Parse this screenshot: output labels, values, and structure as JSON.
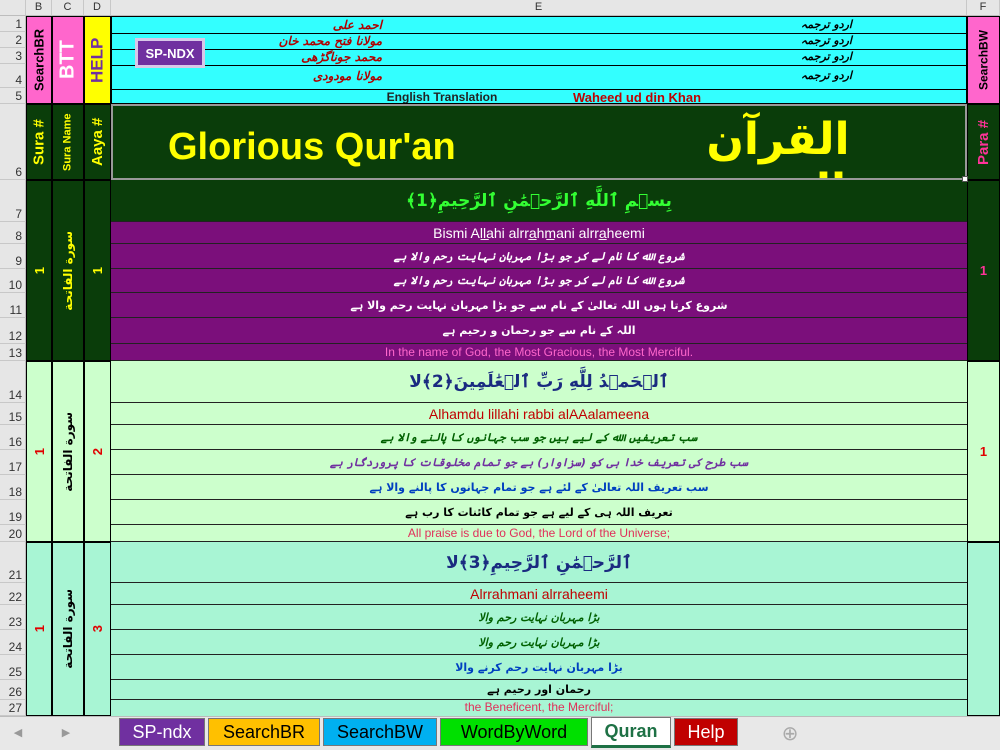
{
  "columns": [
    "B",
    "C",
    "D",
    "E",
    "F"
  ],
  "rows": [
    "1",
    "2",
    "3",
    "4",
    "5",
    "6",
    "7",
    "8",
    "9",
    "10",
    "11",
    "12",
    "13",
    "14",
    "15",
    "16",
    "17",
    "18",
    "19",
    "20",
    "21",
    "22",
    "23",
    "24",
    "25",
    "26",
    "27"
  ],
  "header": {
    "search_br": "SearchBR",
    "btt": "BTT",
    "help": "HELP",
    "search_bw": "SearchBW",
    "sp_ndx": "SP-NDX",
    "translators": [
      {
        "name": "احمد علی",
        "label": "اردو ترجمہ"
      },
      {
        "name": "مولانا فتح محمد خان",
        "label": "اردو ترجمہ"
      },
      {
        "name": "محمد جوناگڑھی",
        "label": "اردو ترجمہ"
      },
      {
        "name": "مولانا مودودی",
        "label": "اردو ترجمہ"
      }
    ],
    "english_label": "English Translation",
    "english_translator": "Waheed ud din Khan",
    "sura_no": "Sura #",
    "sura_name": "Sura Name",
    "aaya_no": "Aaya #",
    "title_en": "Glorious Qur'an",
    "title_ar": "القرآن المجید",
    "para_no": "Para #"
  },
  "verses": [
    {
      "sura": "1",
      "sura_name": "سورة الفاتحة",
      "aaya": "1",
      "para": "1",
      "arabic": "بِسۡمِ ٱللَّهِ ٱلرَّحۡمَٰنِ ٱلرَّحِيمِ﴿1﴾",
      "transliteration": "Bismi All̲ahi alrra̲hm̲ani alrra̲heemi",
      "urdu": [
        "شروع الله کا نام لے کر جو بڑا مہربان نہایت رحم والا ہے",
        "شروع الله کا نام لے کر جو بڑا مہربان نہایت رحم والا ہے",
        "شروع کرتا ہوں اللہ تعالیٰ کے نام سے جو بڑا مہربان نہایت رحم والا ہے",
        "اللہ کے نام سے جو رحمان و رحیم ہے"
      ],
      "english": "In the name of God, the Most Gracious, the Most Merciful."
    },
    {
      "sura": "1",
      "sura_name": "سورة الفاتحة",
      "aaya": "2",
      "para": "1",
      "arabic": "ٱلۡحَمۡدُ لِلَّهِ رَبِّ ٱلۡعَٰلَمِينَ﴿2﴾لا",
      "transliteration": "Alhamdu lillahi rabbi alAAalameena",
      "urdu": [
        "سب تعریفیں الله کے لیے ہیں جو سب جہانوں کا پالنے والا ہے",
        "سب طرح کی تعریف خدا ہی کو (سزاوار) ہے جو تمام مخلوقات کا پروردگار ہے",
        "سب تعریف اللہ تعالیٰ کے لئے ہے جو تمام جہانوں کا پالنے والا ہے",
        "تعریف اللہ ہی کے لیے ہے جو تمام کائنات کا رب ہے"
      ],
      "english": "All praise is due to God, the Lord of the Universe;"
    },
    {
      "sura": "1",
      "sura_name": "سورة الفاتحة",
      "aaya": "3",
      "para": "",
      "arabic": "ٱلرَّحۡمَٰنِ ٱلرَّحِيمِ﴿3﴾لا",
      "transliteration": "Alrrahmani alrraheemi",
      "urdu": [
        "بڑا مہربان نہایت رحم والا",
        "بڑا مہربان نہایت رحم والا",
        "بڑا مہربان نہایت رحم کرنے والا",
        "رحمان اور رحیم ہے"
      ],
      "english": "the Beneficent, the Merciful;"
    }
  ],
  "tabs": [
    {
      "label": "SP-ndx",
      "bg": "#7030a0",
      "fg": "#ffffff"
    },
    {
      "label": "SearchBR",
      "bg": "#ffc000",
      "fg": "#000000"
    },
    {
      "label": "SearchBW",
      "bg": "#00b0f0",
      "fg": "#000000"
    },
    {
      "label": "WordByWord",
      "bg": "#00e000",
      "fg": "#000000"
    },
    {
      "label": "Quran",
      "bg": "#ffffff",
      "fg": "#1e7145",
      "active": true
    },
    {
      "label": "Help",
      "bg": "#c00000",
      "fg": "#ffffff"
    }
  ],
  "nav": {
    "prev": "◀",
    "next": "▶",
    "add": "⊕"
  },
  "colors": {
    "cyan": "#33ffff",
    "dark_green": "#0a3d0a",
    "purple": "#7b0f7b",
    "light_green": "#ccffcc",
    "mint": "#a8f5d4",
    "pink": "#ff66cc",
    "yellow": "#ffff00"
  }
}
